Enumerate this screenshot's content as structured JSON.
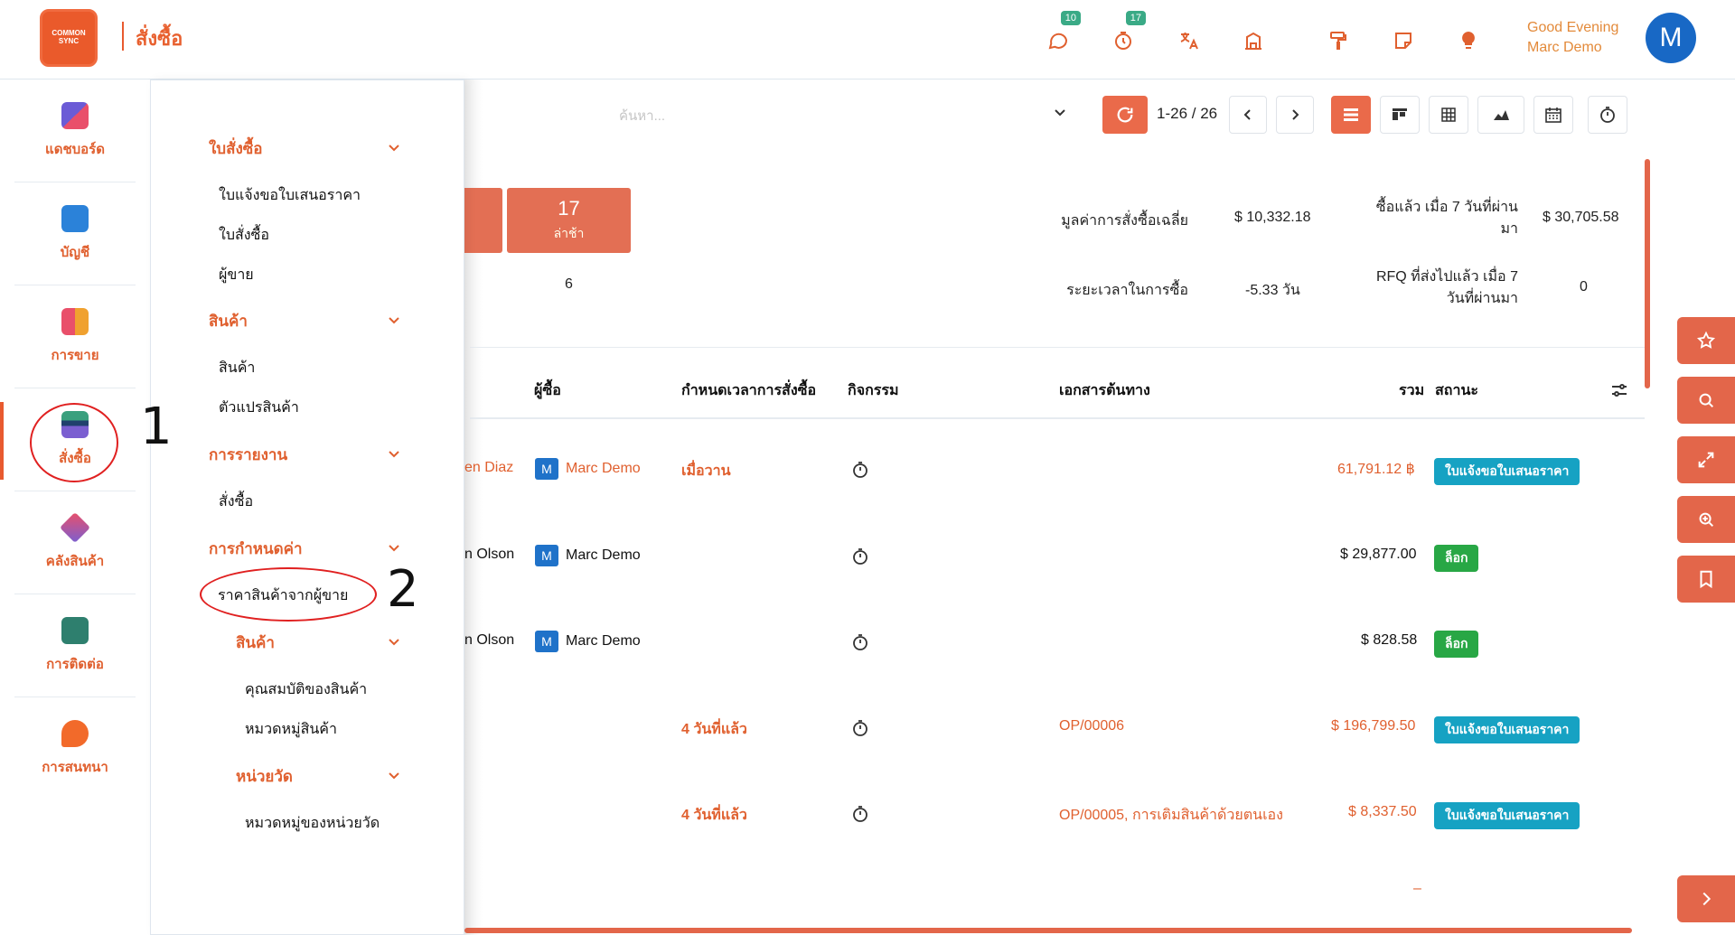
{
  "header": {
    "logo_text": "COMMON SYNC",
    "app_title": "สั่งซื้อ",
    "messages_badge": "10",
    "activities_badge": "17",
    "greeting": "Good Evening",
    "user_name": "Marc Demo",
    "avatar_initial": "M"
  },
  "sidebar": {
    "items": [
      {
        "label": "แดชบอร์ด",
        "icon": "dashboard-icon"
      },
      {
        "label": "บัญชี",
        "icon": "accounting-icon"
      },
      {
        "label": "การขาย",
        "icon": "sales-icon"
      },
      {
        "label": "สั่งซื้อ",
        "icon": "purchase-icon"
      },
      {
        "label": "คลังสินค้า",
        "icon": "inventory-icon"
      },
      {
        "label": "การติดต่อ",
        "icon": "contacts-icon"
      },
      {
        "label": "การสนทนา",
        "icon": "discuss-icon"
      }
    ]
  },
  "menu": {
    "orders_head": "ใบสั่งซื้อ",
    "rfq": "ใบแจ้งขอใบเสนอราคา",
    "purchase_orders": "ใบสั่งซื้อ",
    "vendors": "ผู้ขาย",
    "products_head": "สินค้า",
    "products": "สินค้า",
    "variants": "ตัวแปรสินค้า",
    "reporting_head": "การรายงาน",
    "purchase_report": "สั่งซื้อ",
    "config_head": "การกำหนดค่า",
    "vendor_pricelists": "ราคาสินค้าจากผู้ขาย",
    "config_products_head": "สินค้า",
    "attributes": "คุณสมบัติของสินค้า",
    "categories": "หมวดหมู่สินค้า",
    "uom_head": "หน่วยวัด",
    "uom_categories": "หมวดหมู่ของหน่วยวัด"
  },
  "toolbar": {
    "search_placeholder": "ค้นหา...",
    "pager": "1-26 / 26"
  },
  "stats": {
    "late_count": "17",
    "late_label": "ล่าช้า",
    "under_value": "6",
    "avg_order_label": "มูลค่าการสั่งซื้อเฉลี่ย",
    "avg_order_value": "$ 10,332.18",
    "lead_time_label": "ระยะเวลาในการซื้อ",
    "lead_time_value": "-5.33 วัน",
    "bought_label_1": "ซื้อแล้ว เมื่อ 7 วันที่ผ่าน",
    "bought_label_2": "มา",
    "bought_value": "$ 30,705.58",
    "rfq_sent_label_1": "RFQ ที่ส่งไปแล้ว เมื่อ 7",
    "rfq_sent_label_2": "วันที่ผ่านมา",
    "rfq_sent_value": "0"
  },
  "table": {
    "headers": {
      "buyer": "ผู้ซื้อ",
      "deadline": "กำหนดเวลาการสั่งซื้อ",
      "activities": "กิจกรรม",
      "source": "เอกสารต้นทาง",
      "total": "รวม",
      "status": "สถานะ"
    },
    "rows": [
      {
        "vendor": "en Diaz",
        "buyer": "Marc Demo",
        "deadline": "เมื่อวาน",
        "source": "",
        "total": "61,791.12 ฿",
        "status": "ใบแจ้งขอใบเสนอราคา"
      },
      {
        "vendor": "n Olson",
        "buyer": "Marc Demo",
        "deadline": "",
        "source": "",
        "total": "$ 29,877.00",
        "status": "ล็อก"
      },
      {
        "vendor": "n Olson",
        "buyer": "Marc Demo",
        "deadline": "",
        "source": "",
        "total": "$ 828.58",
        "status": "ล็อก"
      },
      {
        "vendor": "",
        "buyer": "",
        "deadline": "4 วันที่แล้ว",
        "source": "OP/00006",
        "total": "$ 196,799.50",
        "status": "ใบแจ้งขอใบเสนอราคา"
      },
      {
        "vendor": "",
        "buyer": "",
        "deadline": "4 วันที่แล้ว",
        "source": "OP/00005, การเติมสินค้าด้วยตนเอง",
        "total": "$ 8,337.50",
        "status": "ใบแจ้งขอใบเสนอราคา"
      }
    ],
    "last_dash": "–"
  },
  "annotations": {
    "one": "1",
    "two": "2"
  },
  "colors": {
    "brand": "#e85a2f",
    "rfq_badge": "#16a2c3",
    "lock_badge": "#28a745",
    "buyer_avatar": "#1f72c9"
  }
}
